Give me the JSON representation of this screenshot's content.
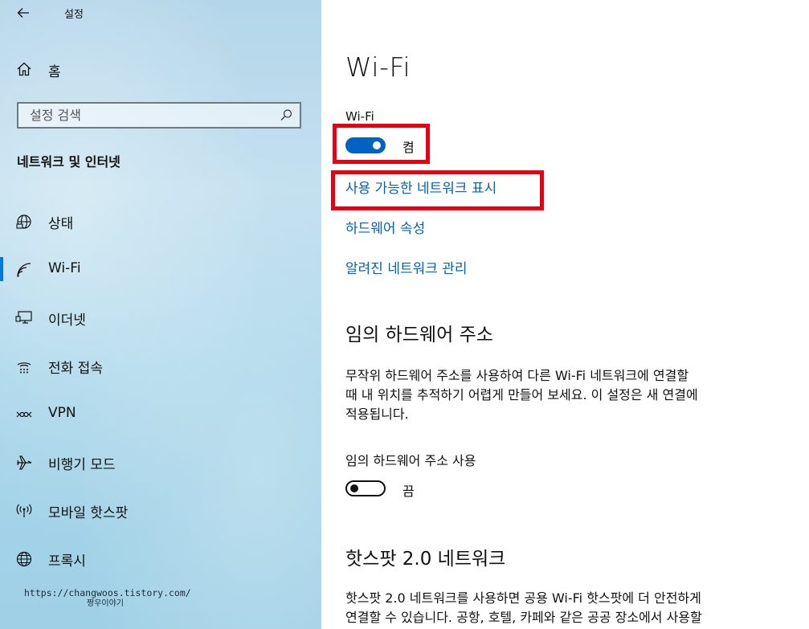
{
  "window": {
    "app_title": "설정"
  },
  "sidebar": {
    "home_label": "홈",
    "search_placeholder": "설정 검색",
    "section_title": "네트워크 및 인터넷",
    "items": [
      {
        "label": "상태",
        "icon": "globe-status-icon"
      },
      {
        "label": "Wi-Fi",
        "icon": "wifi-icon",
        "selected": true
      },
      {
        "label": "이더넷",
        "icon": "ethernet-icon"
      },
      {
        "label": "전화 접속",
        "icon": "dial-up-icon"
      },
      {
        "label": "VPN",
        "icon": "vpn-icon"
      },
      {
        "label": "비행기 모드",
        "icon": "airplane-icon"
      },
      {
        "label": "모바일 핫스팟",
        "icon": "hotspot-icon"
      },
      {
        "label": "프록시",
        "icon": "globe-icon"
      }
    ],
    "watermark_line1": "https://changwoos.tistory.com/",
    "watermark_line2": "짱우이야기"
  },
  "main": {
    "page_title": "Wi-Fi",
    "wifi_toggle": {
      "label": "Wi-Fi",
      "state_text": "켬",
      "on": true
    },
    "links": {
      "show_networks": "사용 가능한 네트워크 표시",
      "hardware_properties": "하드웨어 속성",
      "manage_known": "알려진 네트워크 관리"
    },
    "random_hw": {
      "heading": "임의 하드웨어 주소",
      "description": "무작위 하드웨어 주소를 사용하여 다른 Wi-Fi 네트워크에 연결할\n때 내 위치를 추적하기 어렵게 만들어 보세요. 이 설정은 새 연결에\n적용됩니다.",
      "toggle_label": "임의 하드웨어 주소 사용",
      "state_text": "끔",
      "on": false
    },
    "hotspot2": {
      "heading": "핫스팟 2.0 네트워크",
      "description": "핫스팟 2.0 네트워크를 사용하면 공용 Wi-Fi 핫스팟에 더 안전하게\n연결할 수 있습니다. 공항, 호텔, 카페와 같은 공공 장소에서 사용할"
    }
  },
  "colors": {
    "accent": "#0063c3",
    "link": "#0063b1",
    "highlight_box": "#e60012"
  }
}
